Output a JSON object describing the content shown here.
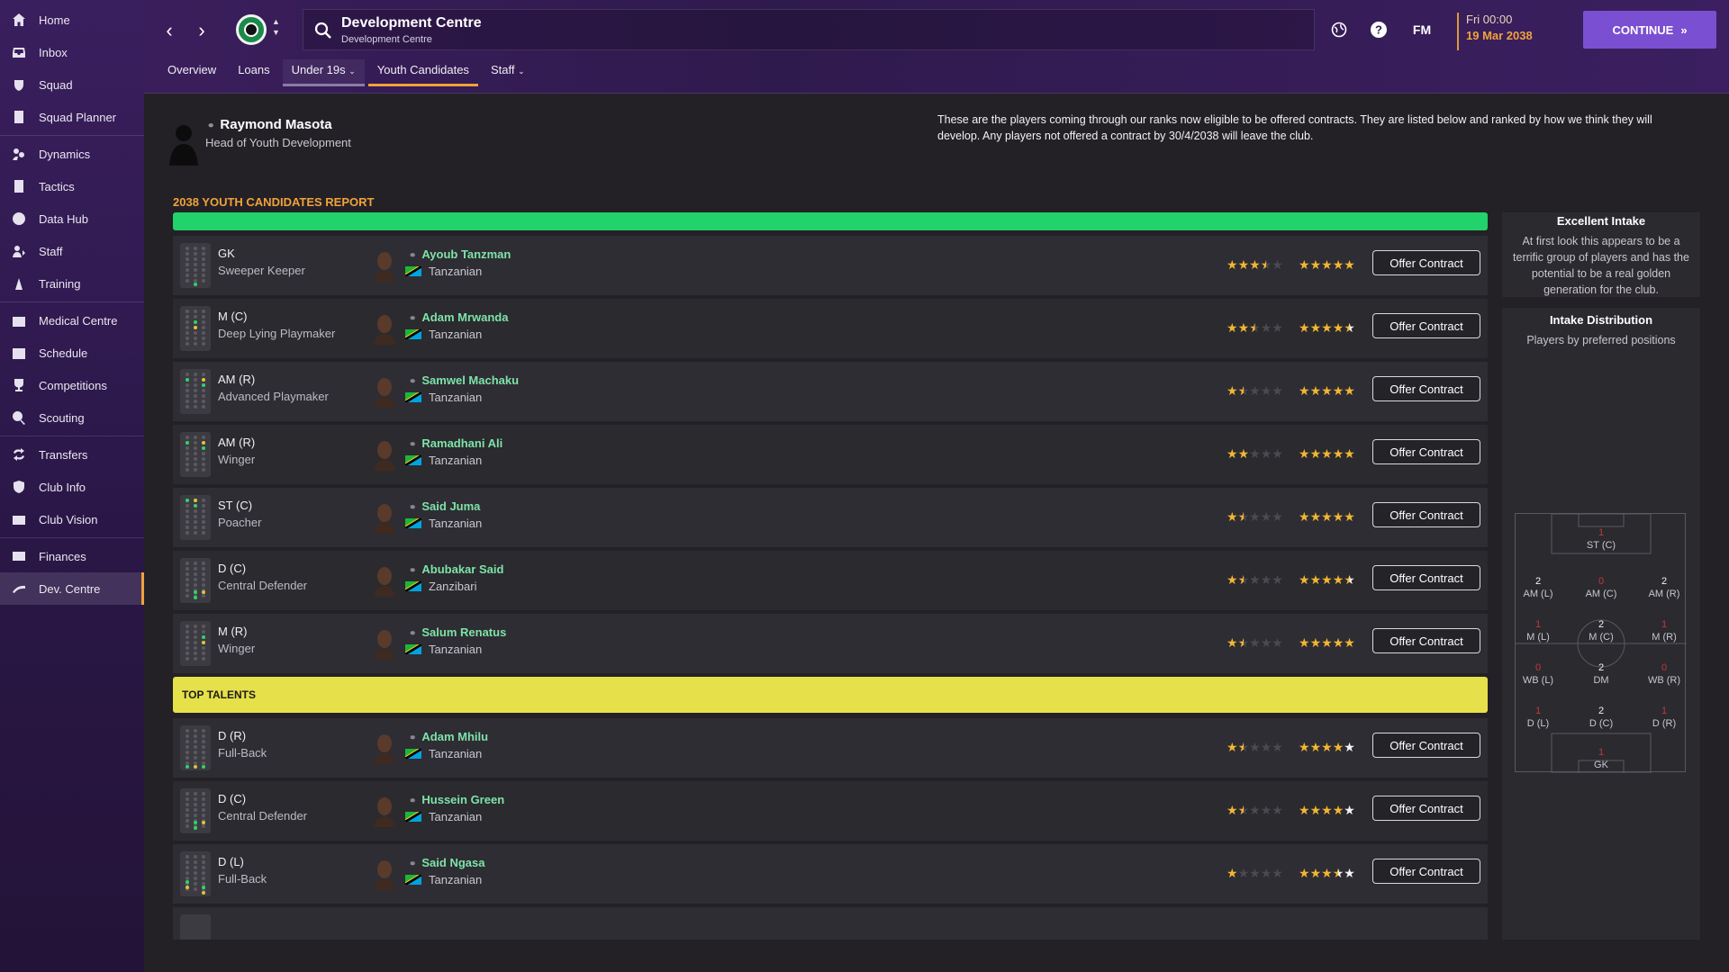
{
  "sidebar": {
    "items": [
      {
        "label": "Home",
        "icon": "home-icon"
      },
      {
        "label": "Inbox",
        "icon": "inbox-icon"
      },
      {
        "label": "Squad",
        "icon": "squad-icon"
      },
      {
        "label": "Squad Planner",
        "icon": "planner-icon"
      },
      {
        "label": "Dynamics",
        "icon": "dynamics-icon"
      },
      {
        "label": "Tactics",
        "icon": "tactics-icon"
      },
      {
        "label": "Data Hub",
        "icon": "data-hub-icon"
      },
      {
        "label": "Staff",
        "icon": "staff-icon"
      },
      {
        "label": "Training",
        "icon": "training-icon"
      },
      {
        "label": "Medical Centre",
        "icon": "medical-icon"
      },
      {
        "label": "Schedule",
        "icon": "calendar-icon"
      },
      {
        "label": "Competitions",
        "icon": "trophy-icon"
      },
      {
        "label": "Scouting",
        "icon": "scouting-icon"
      },
      {
        "label": "Transfers",
        "icon": "transfers-icon"
      },
      {
        "label": "Club Info",
        "icon": "shield-icon"
      },
      {
        "label": "Club Vision",
        "icon": "vision-icon"
      },
      {
        "label": "Finances",
        "icon": "finances-icon"
      },
      {
        "label": "Dev. Centre",
        "icon": "dev-centre-icon"
      }
    ]
  },
  "header": {
    "title": "Development Centre",
    "subtitle": "Development Centre",
    "fm_label": "FM",
    "date_time": "Fri 00:00",
    "date_day": "19 Mar 2038",
    "continue_label": "CONTINUE"
  },
  "tabs": [
    "Overview",
    "Loans",
    "Under 19s",
    "Youth Candidates",
    "Staff"
  ],
  "head": {
    "name": "Raymond Masota",
    "role": "Head of Youth Development",
    "description": "These are the players coming through our ranks now eligible to be offered contracts. They are listed below and ranked by how we think they will develop. Any players not offered a contract by 30/4/2038 will leave the club."
  },
  "report_title": "2038 YOUTH CANDIDATES REPORT",
  "top_talents_label": "TOP TALENTS",
  "offer_label": "Offer Contract",
  "players": [
    {
      "pos": "GK",
      "role": "Sweeper Keeper",
      "name": "Ayoub Tanzman",
      "nat": "Tanzanian",
      "ca": 3.5,
      "pa": 5
    },
    {
      "pos": "M (C)",
      "role": "Deep Lying Playmaker",
      "name": "Adam Mrwanda",
      "nat": "Tanzanian",
      "ca": 2.5,
      "pa": 4.5
    },
    {
      "pos": "AM (R)",
      "role": "Advanced Playmaker",
      "name": "Samwel Machaku",
      "nat": "Tanzanian",
      "ca": 1.5,
      "pa": 5
    },
    {
      "pos": "AM (R)",
      "role": "Winger",
      "name": "Ramadhani Ali",
      "nat": "Tanzanian",
      "ca": 2,
      "pa": 5
    },
    {
      "pos": "ST (C)",
      "role": "Poacher",
      "name": "Said Juma",
      "nat": "Tanzanian",
      "ca": 1.5,
      "pa": 5
    },
    {
      "pos": "D (C)",
      "role": "Central Defender",
      "name": "Abubakar Said",
      "nat": "Zanzibari",
      "ca": 1.5,
      "pa": 4.5
    },
    {
      "pos": "M (R)",
      "role": "Winger",
      "name": "Salum Renatus",
      "nat": "Tanzanian",
      "ca": 1.5,
      "pa": 5
    }
  ],
  "talents": [
    {
      "pos": "D (R)",
      "role": "Full-Back",
      "name": "Adam Mhilu",
      "nat": "Tanzanian",
      "ca": 1.5,
      "pa": 4
    },
    {
      "pos": "D (C)",
      "role": "Central Defender",
      "name": "Hussein Green",
      "nat": "Tanzanian",
      "ca": 1.5,
      "pa": 4
    },
    {
      "pos": "D (L)",
      "role": "Full-Back",
      "name": "Said Ngasa",
      "nat": "Tanzanian",
      "ca": 1,
      "pa": 3.5
    }
  ],
  "panel_intake": {
    "title": "Excellent Intake",
    "text": "At first look this appears to be a terrific group of players and has the potential to be a real golden generation for the club."
  },
  "panel_dist": {
    "title": "Intake Distribution",
    "subtitle": "Players by preferred positions",
    "cells": [
      {
        "label": "ST (C)",
        "n": "1"
      },
      {
        "label": "AM (L)",
        "n": "2"
      },
      {
        "label": "AM (C)",
        "n": "0"
      },
      {
        "label": "AM (R)",
        "n": "2"
      },
      {
        "label": "M (L)",
        "n": "1"
      },
      {
        "label": "M (C)",
        "n": "2"
      },
      {
        "label": "M (R)",
        "n": "1"
      },
      {
        "label": "WB (L)",
        "n": "0"
      },
      {
        "label": "DM",
        "n": "2"
      },
      {
        "label": "WB (R)",
        "n": "0"
      },
      {
        "label": "D (L)",
        "n": "1"
      },
      {
        "label": "D (C)",
        "n": "2"
      },
      {
        "label": "D (R)",
        "n": "1"
      },
      {
        "label": "GK",
        "n": "1"
      }
    ]
  },
  "colors": {
    "accent": "#f0a23a",
    "green_banner": "#21d36a",
    "yellow_banner": "#e6e04a",
    "player_name": "#7ee3a8",
    "continue": "#7b4fd1"
  }
}
